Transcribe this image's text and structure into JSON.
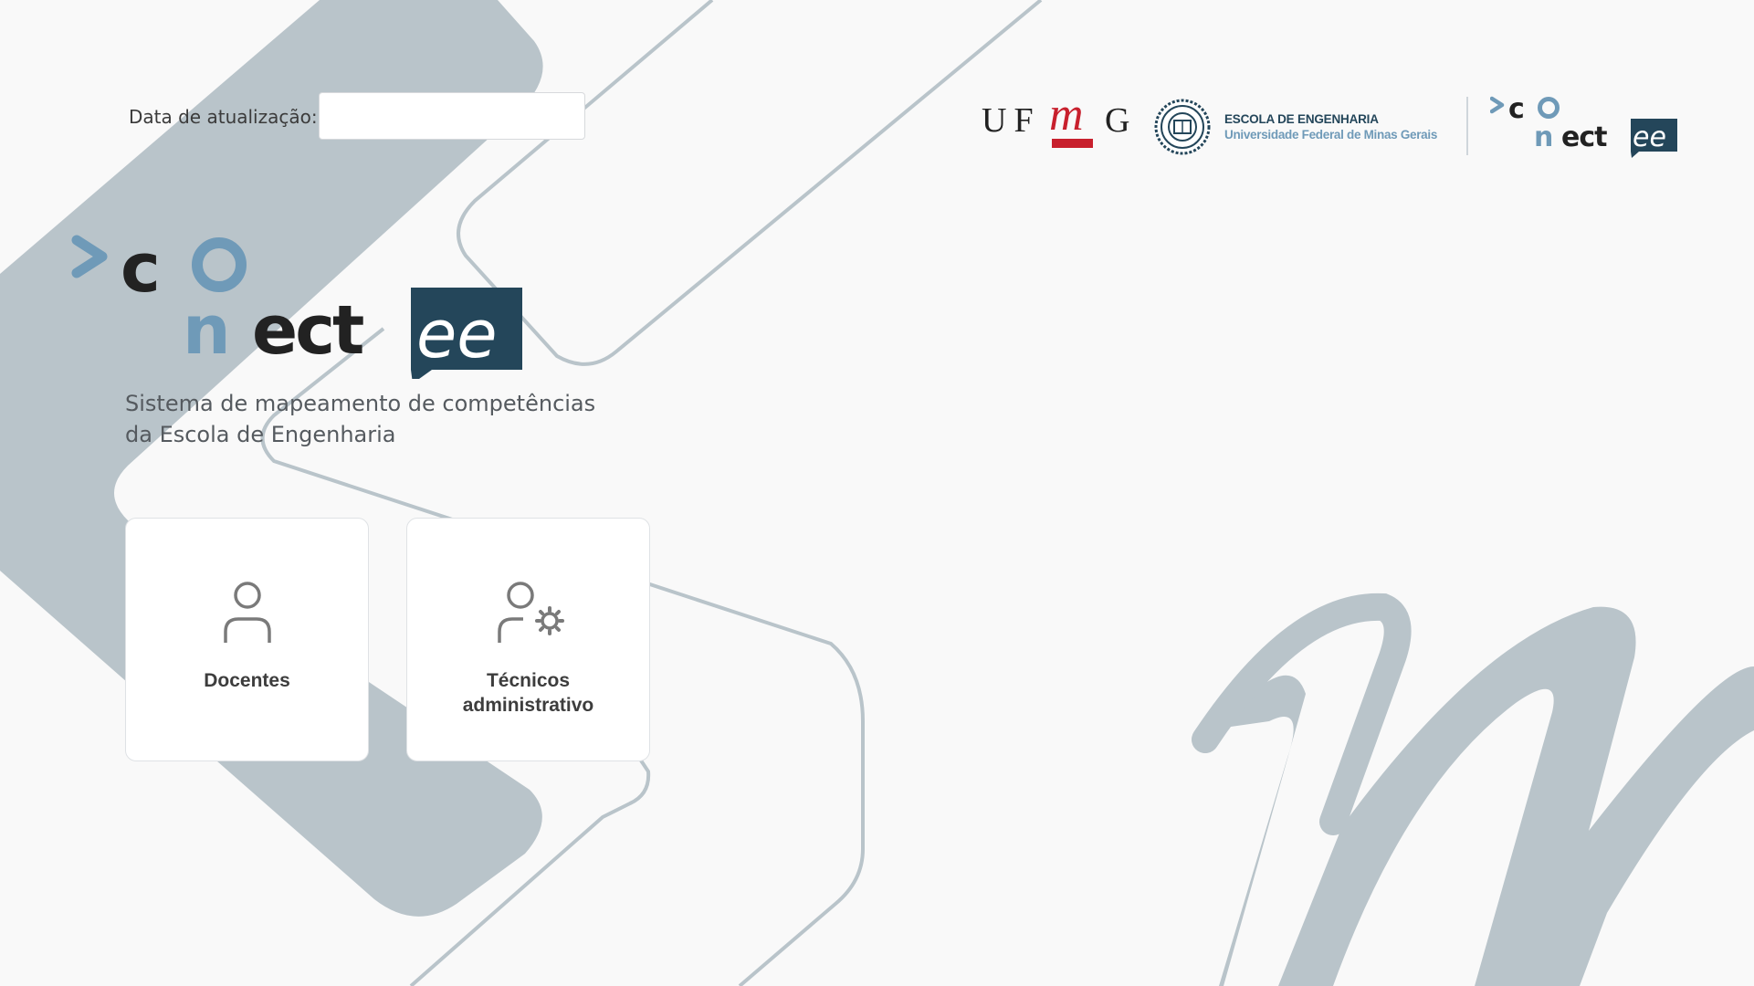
{
  "update": {
    "label": "Data de atualização:",
    "value": ""
  },
  "brand": {
    "name": "conectee",
    "subtitle_line1": "Sistema de mapeamento de competências",
    "subtitle_line2": "da Escola de Engenharia"
  },
  "cards": [
    {
      "label_line1": "Docentes",
      "label_line2": "",
      "icon": "user-icon"
    },
    {
      "label_line1": "Técnicos",
      "label_line2": "administrativo",
      "icon": "user-gear-icon"
    }
  ],
  "header": {
    "ufmg_logo": "UFMG",
    "school_name": "ESCOLA DE ENGENHARIA",
    "university_name": "Universidade Federal de Minas Gerais",
    "seal_icon": "ee-seal-icon"
  },
  "colors": {
    "background": "#f9f9f9",
    "shape_gray": "#b9c4ca",
    "brand_dark": "#24465a",
    "brand_blue": "#6f9ab8",
    "text_dark": "#222222",
    "ufmg_red": "#c8202d"
  }
}
